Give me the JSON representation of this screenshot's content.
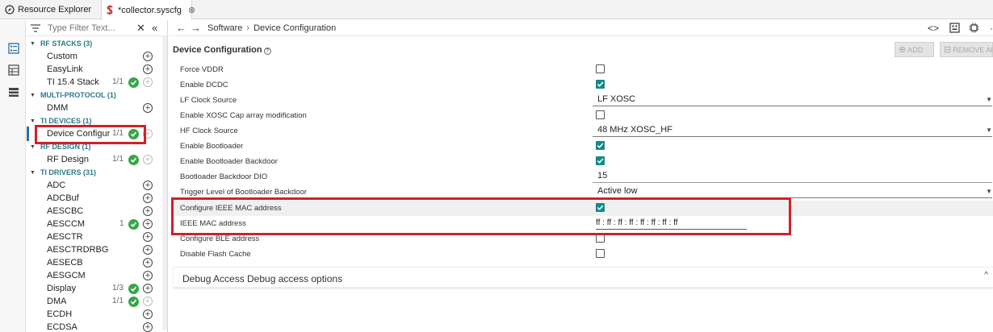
{
  "tabs": [
    {
      "label": "Resource Explorer",
      "icon": "compass-icon"
    },
    {
      "label": "*collector.syscfg",
      "icon": "syscfg-icon",
      "close": "⊗"
    }
  ],
  "filter": {
    "placeholder": "Type Filter Text..."
  },
  "tree": {
    "categories": [
      {
        "label": "RF STACKS (3)"
      },
      {
        "label": "MULTI-PROTOCOL (1)"
      },
      {
        "label": "TI DEVICES (1)"
      },
      {
        "label": "RF DESIGN (1)"
      },
      {
        "label": "TI DRIVERS (31)"
      }
    ],
    "items": [
      {
        "name": "Custom"
      },
      {
        "name": "EasyLink"
      },
      {
        "name": "TI 15.4 Stack",
        "count": "1/1"
      },
      {
        "name": "DMM"
      },
      {
        "name": "Device Configur...",
        "count": "1/1"
      },
      {
        "name": "RF Design",
        "count": "1/1"
      },
      {
        "name": "ADC"
      },
      {
        "name": "ADCBuf"
      },
      {
        "name": "AESCBC"
      },
      {
        "name": "AESCCM",
        "count": "1"
      },
      {
        "name": "AESCTR"
      },
      {
        "name": "AESCTRDRBG"
      },
      {
        "name": "AESECB"
      },
      {
        "name": "AESGCM"
      },
      {
        "name": "Display",
        "count": "1/3"
      },
      {
        "name": "DMA",
        "count": "1/1"
      },
      {
        "name": "ECDH"
      },
      {
        "name": "ECDSA"
      }
    ]
  },
  "breadcrumb": {
    "part1": "Software",
    "sep": "›",
    "part2": "Device Configuration"
  },
  "section": {
    "title": "Device Configuration",
    "help": "?"
  },
  "buttons": {
    "add": "ADD",
    "remove": "REMOVE AL"
  },
  "fields": [
    {
      "label": "Force VDDR",
      "checked": false
    },
    {
      "label": "Enable DCDC",
      "checked": true
    },
    {
      "label": "LF Clock Source",
      "value": "LF XOSC"
    },
    {
      "label": "Enable XOSC Cap array modification",
      "checked": false
    },
    {
      "label": "HF Clock Source",
      "value": "48 MHz XOSC_HF"
    },
    {
      "label": "Enable Bootloader",
      "checked": true
    },
    {
      "label": "Enable Bootloader Backdoor",
      "checked": true
    },
    {
      "label": "Bootloader Backdoor DIO",
      "value": "15"
    },
    {
      "label": "Trigger Level of Bootloader Backdoor",
      "value": "Active low"
    },
    {
      "label": "Configure IEEE MAC address",
      "checked": true
    },
    {
      "label": "IEEE MAC address",
      "mac": [
        "ff",
        "ff",
        "ff",
        "ff",
        "ff",
        "ff",
        "ff",
        "ff"
      ]
    },
    {
      "label": "Configure BLE address",
      "checked": false
    },
    {
      "label": "Disable Flash Cache",
      "checked": false
    }
  ],
  "debug": {
    "title": "Debug Access",
    "subtitle": "Debug access options"
  },
  "colors": {
    "accent": "#138a8a",
    "highlight_box": "#d0202a",
    "ok": "#3aa44a"
  }
}
